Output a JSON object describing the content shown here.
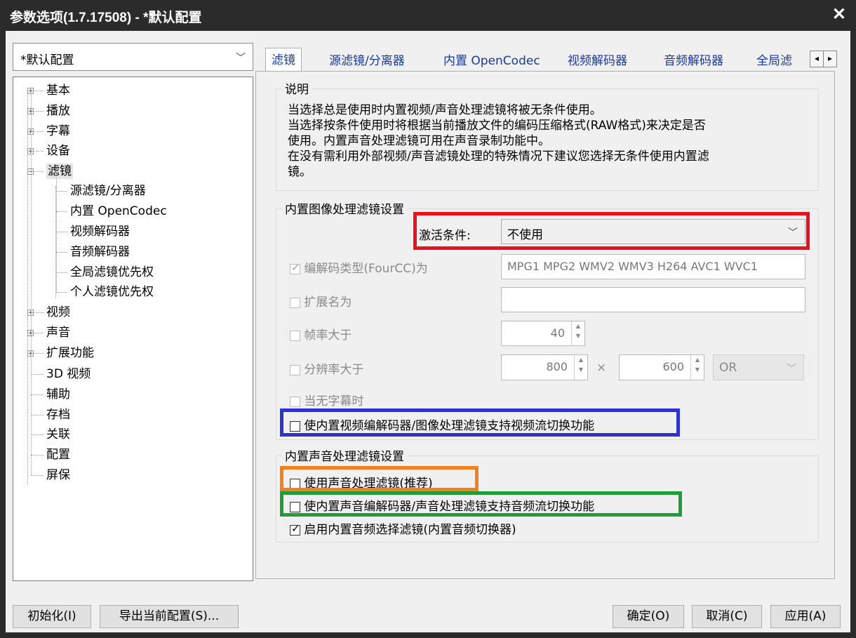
{
  "window": {
    "title": "参数选项(1.7.17508) - *默认配置",
    "close": "✕"
  },
  "profile": {
    "selected": "*默认配置"
  },
  "tree": [
    {
      "label": "基本",
      "expander": "+"
    },
    {
      "label": "播放",
      "expander": "+"
    },
    {
      "label": "字幕",
      "expander": "+"
    },
    {
      "label": "设备",
      "expander": "+"
    },
    {
      "label": "滤镜",
      "expander": "−"
    },
    {
      "label": "源滤镜/分离器"
    },
    {
      "label": "内置 OpenCodec"
    },
    {
      "label": "视频解码器"
    },
    {
      "label": "音频解码器"
    },
    {
      "label": "全局滤镜优先权"
    },
    {
      "label": "个人滤镜优先权"
    },
    {
      "label": "视频",
      "expander": "+"
    },
    {
      "label": "声音",
      "expander": "+"
    },
    {
      "label": "扩展功能",
      "expander": "+"
    },
    {
      "label": "3D 视频"
    },
    {
      "label": "辅助"
    },
    {
      "label": "存档"
    },
    {
      "label": "关联"
    },
    {
      "label": "配置"
    },
    {
      "label": "屏保"
    }
  ],
  "tabs": [
    "滤镜",
    "源滤镜/分离器",
    "内置 OpenCodec",
    "视频解码器",
    "音频解码器",
    "全局滤"
  ],
  "tab_scroll": {
    "left": "◂",
    "right": "▸"
  },
  "description": {
    "title": "说明",
    "lines": [
      "当选择总是使用时内置视频/声音处理滤镜将被无条件使用。",
      "当选择按条件使用时将根据当前播放文件的编码压缩格式(RAW格式)来决定是否",
      "使用。内置声音处理滤镜可用在声音录制功能中。",
      "在没有需利用外部视频/声音滤镜处理的特殊情况下建议您选择无条件使用内置滤",
      "镜。"
    ]
  },
  "video_group": {
    "title": "内置图像处理滤镜设置",
    "activate_label": "激活条件:",
    "activate_value": "不使用",
    "fourcc_label": "编解码类型(FourCC)为",
    "fourcc_value": "MPG1 MPG2 WMV2 WMV3 H264 AVC1 WVC1",
    "ext_label": "扩展名为",
    "ext_value": "",
    "fps_label": "帧率大于",
    "fps_value": "40",
    "res_label": "分辨率大于",
    "res_w": "800",
    "res_x": "×",
    "res_h": "600",
    "res_op": "OR",
    "nosub_label": "当无字幕时",
    "stream_switch_label": "使内置视频编解码器/图像处理滤镜支持视频流切换功能"
  },
  "audio_group": {
    "title": "内置声音处理滤镜设置",
    "use_audio_filter_label": "使用声音处理滤镜(推荐)",
    "audio_switch_label": "使内置声音编解码器/声音处理滤镜支持音频流切换功能",
    "audio_selector_label": "启用内置音频选择滤镜(内置音频切换器)"
  },
  "buttons": {
    "init": "初始化(I)",
    "export": "导出当前配置(S)...",
    "ok": "确定(O)",
    "cancel": "取消(C)",
    "apply": "应用(A)"
  },
  "highlight_colors": {
    "red": "#e8121e",
    "blue": "#2d35c9",
    "orange": "#f47f1d",
    "green": "#1e9e3a"
  }
}
